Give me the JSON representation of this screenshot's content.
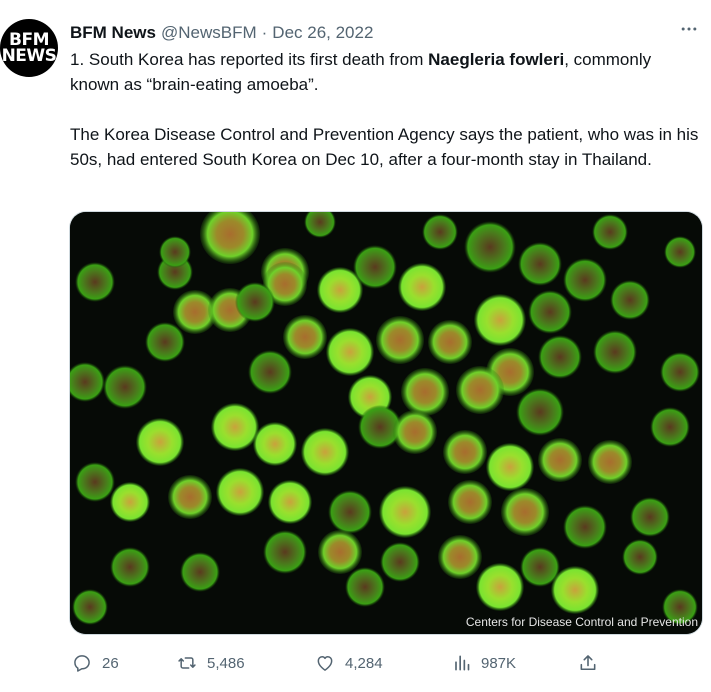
{
  "account": {
    "avatar_line1": "BFM",
    "avatar_line2": "NEWS",
    "name": "BFM News",
    "handle": "@NewsBFM",
    "separator": "·",
    "date": "Dec 26, 2022"
  },
  "tweet": {
    "p1_before": "1. South Korea has reported its first death from ",
    "p1_bold": "Naegleria fowleri",
    "p1_after": ", commonly known as “brain-eating amoeba”.",
    "p2": "The Korea Disease Control and Prevention Agency says the patient, who was in his 50s, had entered South Korea on Dec 10, after a four-month stay in Thailand."
  },
  "media": {
    "credit": "Centers for Disease Control and Prevention",
    "icon": "microscope-image"
  },
  "actions": {
    "replies": "26",
    "retweets": "5,486",
    "likes": "4,284",
    "views": "987K"
  },
  "icons": {
    "more": "more-icon",
    "reply": "reply-icon",
    "retweet": "retweet-icon",
    "like": "heart-icon",
    "views": "views-icon",
    "share": "share-icon"
  },
  "colors": {
    "text": "#0f1419",
    "secondary": "#536471",
    "amoeba_green": "#5fd62a",
    "amoeba_core": "#b8863a"
  }
}
